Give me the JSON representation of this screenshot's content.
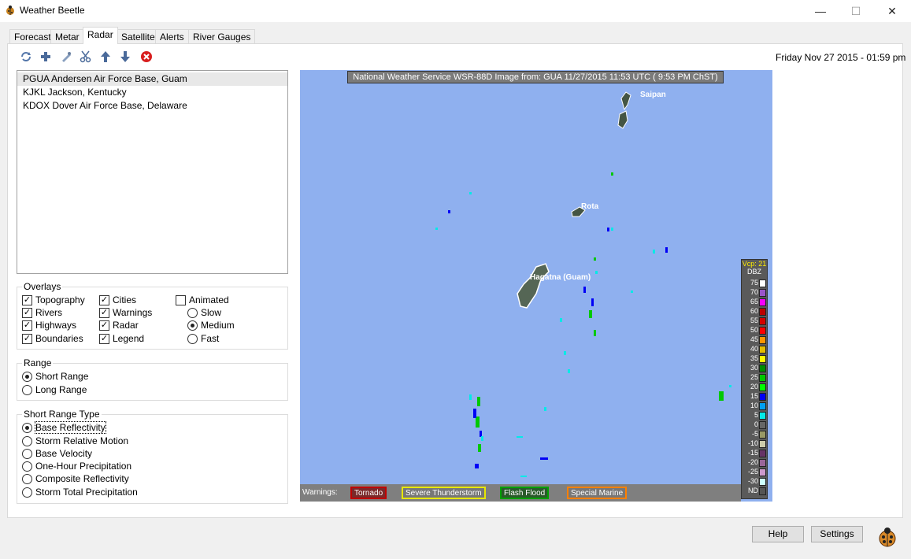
{
  "window": {
    "title": "Weather Beetle",
    "minimize": "—",
    "maximize": "☐",
    "close": "✕"
  },
  "tabs": [
    "Forecast",
    "Metar",
    "Radar",
    "Satellite",
    "Alerts",
    "River Gauges"
  ],
  "active_tab": "Radar",
  "toolbar": {
    "icons": [
      "refresh-icon",
      "add-icon",
      "edit-icon",
      "cut-icon",
      "move-up-icon",
      "move-down-icon",
      "delete-icon"
    ]
  },
  "datetime": "Friday Nov 27 2015 - 01:59 pm",
  "stations": [
    "PGUA Andersen Air Force Base, Guam",
    "KJKL Jackson, Kentucky",
    "KDOX Dover Air Force Base, Delaware"
  ],
  "overlays": {
    "label": "Overlays",
    "topography": "Topography",
    "rivers": "Rivers",
    "highways": "Highways",
    "boundaries": "Boundaries",
    "cities": "Cities",
    "warnings": "Warnings",
    "radar": "Radar",
    "legend": "Legend",
    "animated": "Animated",
    "slow": "Slow",
    "medium": "Medium",
    "fast": "Fast"
  },
  "range": {
    "label": "Range",
    "short": "Short Range",
    "long": "Long Range"
  },
  "short_range_type": {
    "label": "Short Range Type",
    "options": [
      "Base Reflectivity",
      "Storm Relative Motion",
      "Base Velocity",
      "One-Hour Precipitation",
      "Composite Reflectivity",
      "Storm Total Precipitation"
    ]
  },
  "radar": {
    "header": "National Weather Service WSR-88D Image from:  GUA 11/27/2015 11:53 UTC ( 9:53 PM ChST)",
    "cities": {
      "saipan": "Saipan",
      "rota": "Rota",
      "hagatna": "Hagatna (Guam)"
    },
    "warnings_label": "Warnings:",
    "warnings": [
      "Tornado",
      "Severe Thunderstorm",
      "Flash Flood",
      "Special Marine"
    ],
    "warning_colors": [
      "#c00000",
      "#e8e800",
      "#00a000",
      "#ff8000"
    ],
    "legend_title": "Vcp: 21",
    "legend_unit": "DBZ",
    "legend_values": [
      "75",
      "70",
      "65",
      "60",
      "55",
      "50",
      "45",
      "40",
      "35",
      "30",
      "25",
      "20",
      "15",
      "10",
      "5",
      "0",
      "-5",
      "-10",
      "-15",
      "-20",
      "-25",
      "-30",
      "ND"
    ],
    "legend_colors": [
      "#ffffff",
      "#9955c9",
      "#f800fd",
      "#bc0000",
      "#d40000",
      "#fd0000",
      "#fd9500",
      "#e5bc00",
      "#fdf802",
      "#008e00",
      "#01c801",
      "#02fd02",
      "#0000f6",
      "#019ff4",
      "#04e9e7",
      "#666666",
      "#999966",
      "#ccccaa",
      "#663366",
      "#996699",
      "#cc99cc",
      "#ccffff",
      "#555555"
    ]
  },
  "buttons": {
    "help": "Help",
    "settings": "Settings"
  }
}
